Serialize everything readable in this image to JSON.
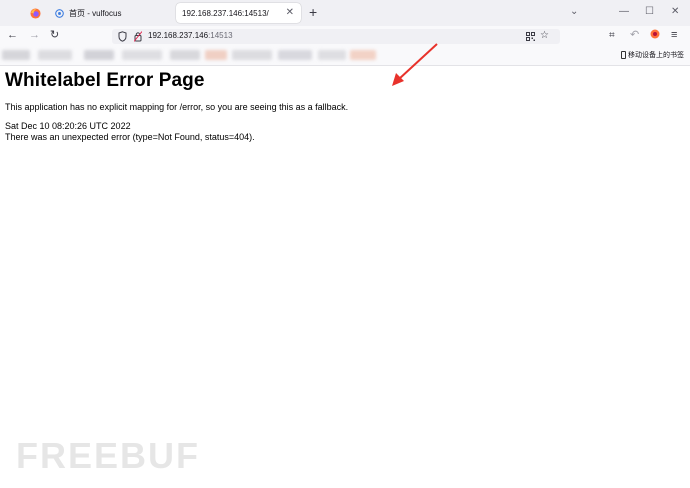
{
  "browser": {
    "tabs": [
      {
        "label": "首页 - vulfocus"
      },
      {
        "label": "192.168.237.146:14513/"
      }
    ],
    "url_host": "192.168.237.146",
    "url_port": ":14513",
    "bookmarks_right": "移动设备上的书签"
  },
  "page": {
    "heading": "Whitelabel Error Page",
    "message": "This application has no explicit mapping for /error, so you are seeing this as a fallback.",
    "timestamp": "Sat Dec 10 08:20:26 UTC 2022",
    "error_detail": "There was an unexpected error (type=Not Found, status=404)."
  },
  "annotation": {
    "arrow_color": "#e8322b"
  },
  "watermark": "FREEBUF",
  "colors": {
    "tabbar_bg": "#f0f0f4",
    "navbar_bg": "#f9f9fb",
    "firefox_orange": "#ff7139"
  }
}
